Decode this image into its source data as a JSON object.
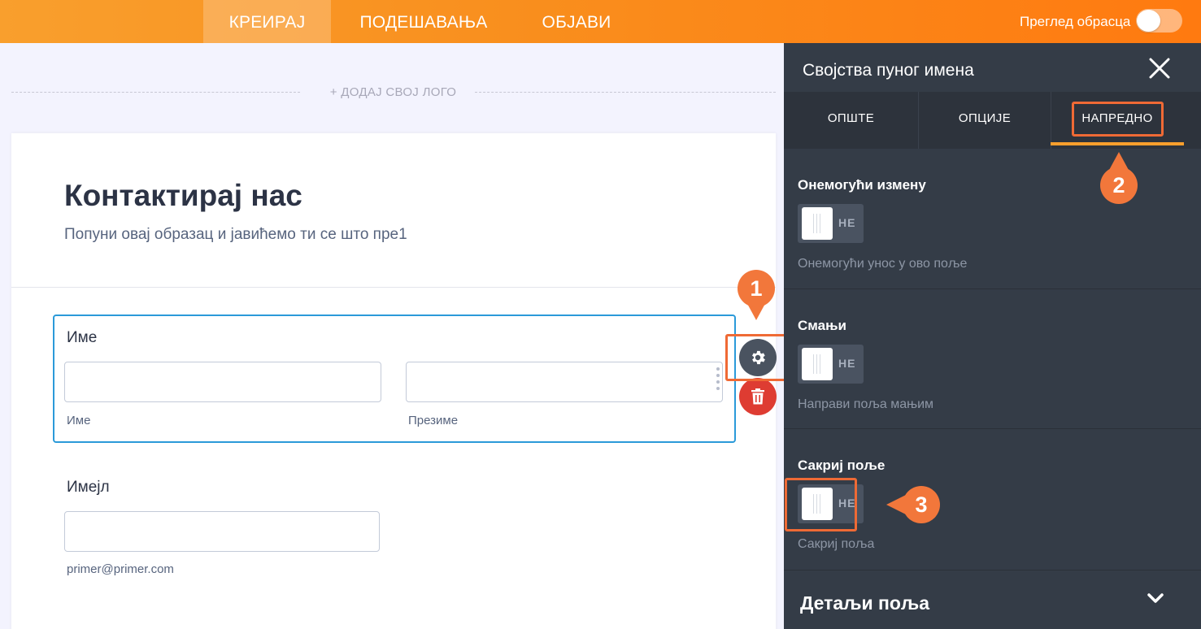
{
  "topbar": {
    "tabs": [
      {
        "label": "КРЕИРАЈ",
        "active": true
      },
      {
        "label": "ПОДЕШАВАЊА",
        "active": false
      },
      {
        "label": "ОБЈАВИ",
        "active": false
      }
    ],
    "preview_label": "Преглед обрасца"
  },
  "form": {
    "add_logo": "+ ДОДАЈ СВОЈ ЛОГО",
    "title": "Контактирај нас",
    "subtitle": "Попуни овај образац и јавићемо ти се што пре1",
    "name_field": {
      "label": "Име",
      "first_sublabel": "Име",
      "last_sublabel": "Презиме"
    },
    "email_field": {
      "label": "Имејл",
      "sublabel": "primer@primer.com"
    }
  },
  "panel": {
    "title": "Својства пуног имена",
    "tabs": [
      {
        "label": "ОПШТЕ"
      },
      {
        "label": "ОПЦИЈЕ"
      },
      {
        "label": "НАПРЕДНО",
        "active": true
      }
    ],
    "sections": [
      {
        "title": "Онемогући измену",
        "toggle": "НЕ",
        "desc": "Онемогући унос у ово поље"
      },
      {
        "title": "Смањи",
        "toggle": "НЕ",
        "desc": "Направи поља мањим"
      },
      {
        "title": "Сакриј поље",
        "toggle": "НЕ",
        "desc": "Сакриј поља"
      }
    ],
    "details_title": "Детаљи поља"
  },
  "markers": {
    "m1": "1",
    "m2": "2",
    "m3": "3"
  },
  "colors": {
    "accent_orange": "#f99f2d",
    "highlight": "#ef6a35",
    "field_focus": "#2b9ad9",
    "panel_bg": "#343c47",
    "delete_red": "#de3c32"
  }
}
